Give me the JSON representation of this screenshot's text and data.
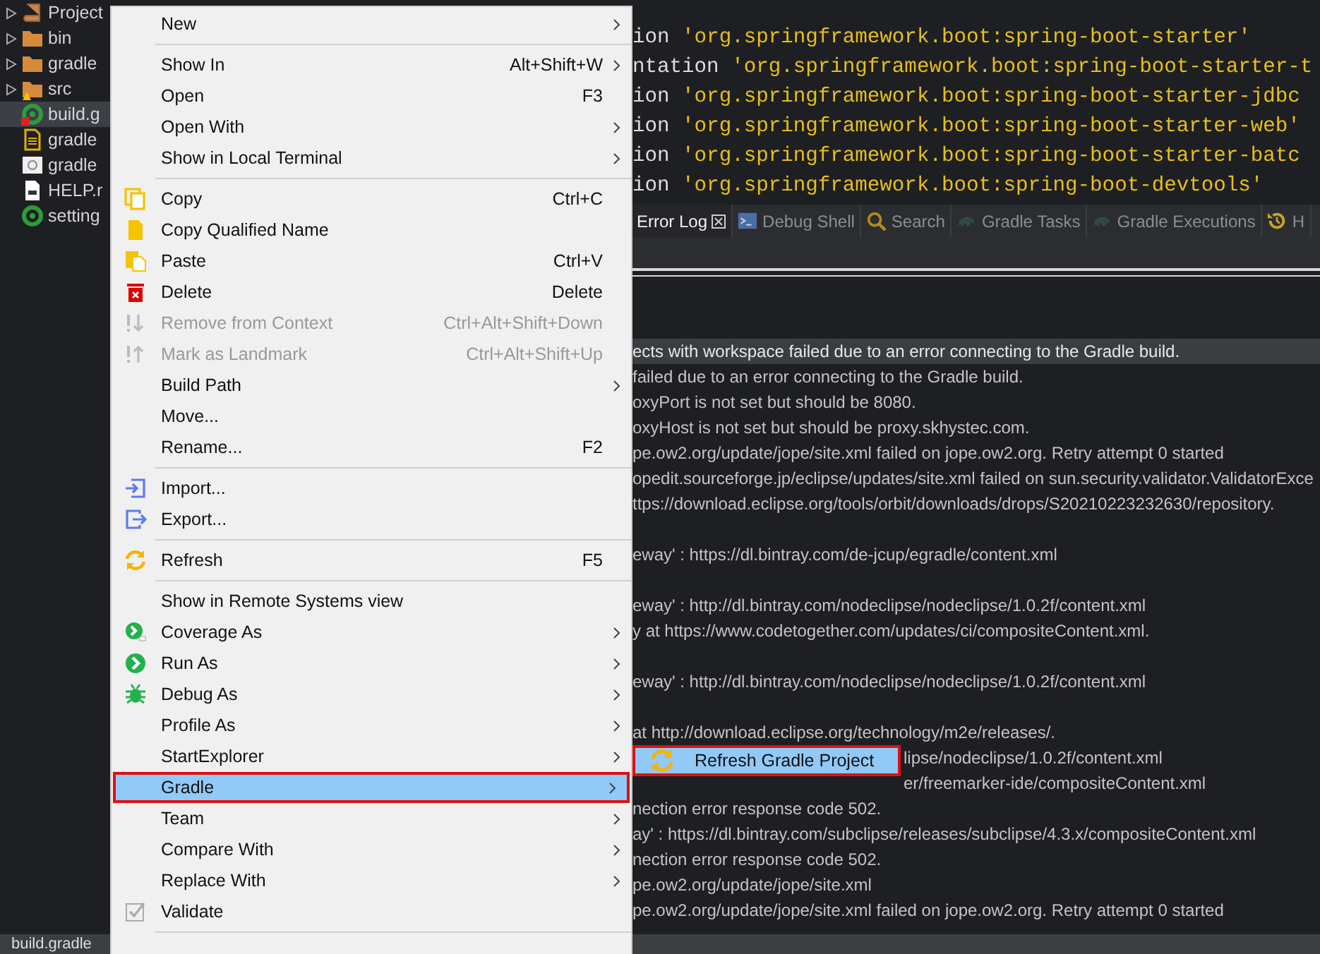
{
  "tree": {
    "items": [
      {
        "label": "Project",
        "expander": true,
        "kind": "library",
        "selected": false
      },
      {
        "label": "bin",
        "expander": true,
        "kind": "folder",
        "selected": false
      },
      {
        "label": "gradle",
        "expander": true,
        "kind": "folder",
        "selected": false
      },
      {
        "label": "src",
        "expander": true,
        "kind": "warnfolder",
        "selected": false
      },
      {
        "label": "build.g",
        "expander": false,
        "kind": "gradleerror",
        "selected": true
      },
      {
        "label": "gradle",
        "expander": false,
        "kind": "textfile",
        "selected": false
      },
      {
        "label": "gradle",
        "expander": false,
        "kind": "scriptfile",
        "selected": false
      },
      {
        "label": "HELP.r",
        "expander": false,
        "kind": "docfile",
        "selected": false
      },
      {
        "label": "setting",
        "expander": false,
        "kind": "gradle",
        "selected": false
      }
    ]
  },
  "status_bar": {
    "file": "build.gradle"
  },
  "context_menu": {
    "items": [
      {
        "kind": "plain",
        "label": "New",
        "submenu": true,
        "disabled": false,
        "selected": false
      },
      {
        "kind": "separator"
      },
      {
        "kind": "plain",
        "label": "Show In",
        "shortcut": "Alt+Shift+W",
        "submenu": true,
        "disabled": false,
        "selected": false
      },
      {
        "kind": "plain",
        "label": "Open",
        "shortcut": "F3",
        "submenu": false,
        "disabled": false,
        "selected": false
      },
      {
        "kind": "plain",
        "label": "Open With",
        "submenu": true,
        "disabled": false,
        "selected": false
      },
      {
        "kind": "plain",
        "label": "Show in Local Terminal",
        "submenu": true,
        "disabled": false,
        "selected": false
      },
      {
        "kind": "separator"
      },
      {
        "kind": "copy",
        "label": "Copy",
        "shortcut": "Ctrl+C",
        "submenu": false,
        "disabled": false,
        "selected": false
      },
      {
        "kind": "document",
        "label": "Copy Qualified Name",
        "submenu": false,
        "disabled": false,
        "selected": false
      },
      {
        "kind": "paste",
        "label": "Paste",
        "shortcut": "Ctrl+V",
        "submenu": false,
        "disabled": false,
        "selected": false
      },
      {
        "kind": "trash",
        "label": "Delete",
        "shortcut": "Delete",
        "submenu": false,
        "disabled": false,
        "selected": false
      },
      {
        "kind": "down",
        "label": "Remove from Context",
        "shortcut": "Ctrl+Alt+Shift+Down",
        "submenu": false,
        "disabled": true,
        "selected": false
      },
      {
        "kind": "up",
        "label": "Mark as Landmark",
        "shortcut": "Ctrl+Alt+Shift+Up",
        "submenu": false,
        "disabled": true,
        "selected": false
      },
      {
        "kind": "plain",
        "label": "Build Path",
        "submenu": true,
        "disabled": false,
        "selected": false
      },
      {
        "kind": "plain",
        "label": "Move...",
        "submenu": false,
        "disabled": false,
        "selected": false
      },
      {
        "kind": "plain",
        "label": "Rename...",
        "shortcut": "F2",
        "submenu": false,
        "disabled": false,
        "selected": false
      },
      {
        "kind": "separator"
      },
      {
        "kind": "import",
        "label": "Import...",
        "submenu": false,
        "disabled": false,
        "selected": false
      },
      {
        "kind": "export",
        "label": "Export...",
        "submenu": false,
        "disabled": false,
        "selected": false
      },
      {
        "kind": "separator"
      },
      {
        "kind": "refresh",
        "label": "Refresh",
        "shortcut": "F5",
        "submenu": false,
        "disabled": false,
        "selected": false
      },
      {
        "kind": "separator"
      },
      {
        "kind": "plain",
        "label": "Show in Remote Systems view",
        "submenu": false,
        "disabled": false,
        "selected": false
      },
      {
        "kind": "coverage",
        "label": "Coverage As",
        "submenu": true,
        "disabled": false,
        "selected": false
      },
      {
        "kind": "run",
        "label": "Run As",
        "submenu": true,
        "disabled": false,
        "selected": false
      },
      {
        "kind": "debug",
        "label": "Debug As",
        "submenu": true,
        "disabled": false,
        "selected": false
      },
      {
        "kind": "plain",
        "label": "Profile As",
        "submenu": true,
        "disabled": false,
        "selected": false
      },
      {
        "kind": "plain",
        "label": "StartExplorer",
        "submenu": true,
        "disabled": false,
        "selected": false
      },
      {
        "kind": "plain",
        "label": "Gradle",
        "submenu": true,
        "disabled": false,
        "selected": true
      },
      {
        "kind": "plain",
        "label": "Team",
        "submenu": true,
        "disabled": false,
        "selected": false
      },
      {
        "kind": "plain",
        "label": "Compare With",
        "submenu": true,
        "disabled": false,
        "selected": false
      },
      {
        "kind": "plain",
        "label": "Replace With",
        "submenu": true,
        "disabled": false,
        "selected": false
      },
      {
        "kind": "validate",
        "label": "Validate",
        "submenu": false,
        "disabled": false,
        "selected": false
      },
      {
        "kind": "separator"
      }
    ]
  },
  "editor": {
    "lines": [
      {
        "keyword": "ion",
        "string": "'org.springframework.boot:spring-boot-starter'"
      },
      {
        "keyword": "ntation",
        "string": "'org.springframework.boot:spring-boot-starter-t"
      },
      {
        "keyword": "ion",
        "string": "'org.springframework.boot:spring-boot-starter-jdbc"
      },
      {
        "keyword": "ion",
        "string": "'org.springframework.boot:spring-boot-starter-web'"
      },
      {
        "keyword": "ion",
        "string": "'org.springframework.boot:spring-boot-starter-batc"
      },
      {
        "keyword": "ion",
        "string": "'org.springframework.boot:spring-boot-devtools'"
      }
    ]
  },
  "view_tabs": [
    {
      "label": "Error Log",
      "kind": "plain",
      "closable": true,
      "selected": true
    },
    {
      "label": "Debug Shell",
      "kind": "terminal",
      "closable": false,
      "selected": false
    },
    {
      "label": "Search",
      "kind": "search",
      "closable": false,
      "selected": false
    },
    {
      "label": "Gradle Tasks",
      "kind": "elephant",
      "closable": false,
      "selected": false
    },
    {
      "label": "Gradle Executions",
      "kind": "elephant",
      "closable": false,
      "selected": false
    },
    {
      "label": "H",
      "kind": "history",
      "closable": false,
      "selected": false
    }
  ],
  "error_log": {
    "rows_above": [
      {
        "text": "ects with workspace failed due to an error connecting to the Gradle build.",
        "gap_before": false,
        "selected": true
      },
      {
        "text": "failed due to an error connecting to the Gradle build.",
        "gap_before": false,
        "selected": false
      },
      {
        "text": "oxyPort is not set but should be 8080.",
        "gap_before": false,
        "selected": false
      },
      {
        "text": "oxyHost is not set but should be proxy.skhystec.com.",
        "gap_before": false,
        "selected": false
      },
      {
        "text": "pe.ow2.org/update/jope/site.xml failed on jope.ow2.org. Retry attempt 0 started",
        "gap_before": false,
        "selected": false
      },
      {
        "text": "opedit.sourceforge.jp/eclipse/updates/site.xml failed on sun.security.validator.ValidatorExce",
        "gap_before": false,
        "selected": false
      },
      {
        "text": "ttps://download.eclipse.org/tools/orbit/downloads/drops/S20210223232630/repository.",
        "gap_before": false,
        "selected": false
      },
      {
        "text": "eway' : https://dl.bintray.com/de-jcup/egradle/content.xml",
        "gap_before": true,
        "selected": false
      },
      {
        "text": "eway' : http://dl.bintray.com/nodeclipse/nodeclipse/1.0.2f/content.xml",
        "gap_before": true,
        "selected": false
      },
      {
        "text": "y at https://www.codetogether.com/updates/ci/compositeContent.xml.",
        "gap_before": false,
        "selected": false
      },
      {
        "text": "eway' : http://dl.bintray.com/nodeclipse/nodeclipse/1.0.2f/content.xml",
        "gap_before": true,
        "selected": false
      },
      {
        "text": "at http://download.eclipse.org/technology/m2e/releases/.",
        "gap_before": true,
        "selected": false
      }
    ],
    "rows_beside_submenu": [
      {
        "text": "lipse/nodeclipse/1.0.2f/content.xml"
      },
      {
        "text": "er/freemarker-ide/compositeContent.xml"
      }
    ],
    "rows_below": [
      {
        "text": "nection error response code 502.",
        "gap_before": false,
        "selected": false
      },
      {
        "text": "ay' : https://dl.bintray.com/subclipse/releases/subclipse/4.3.x/compositeContent.xml",
        "gap_before": false,
        "selected": false
      },
      {
        "text": "nection error response code 502.",
        "gap_before": false,
        "selected": false
      },
      {
        "text": "pe.ow2.org/update/jope/site.xml",
        "gap_before": false,
        "selected": false
      },
      {
        "text": "pe.ow2.org/update/jope/site.xml failed on jope.ow2.org. Retry attempt 0 started",
        "gap_before": false,
        "selected": false
      }
    ]
  },
  "submenu": {
    "items": [
      {
        "label": "Refresh Gradle Project",
        "kind": "refresh",
        "selected": true
      }
    ]
  }
}
